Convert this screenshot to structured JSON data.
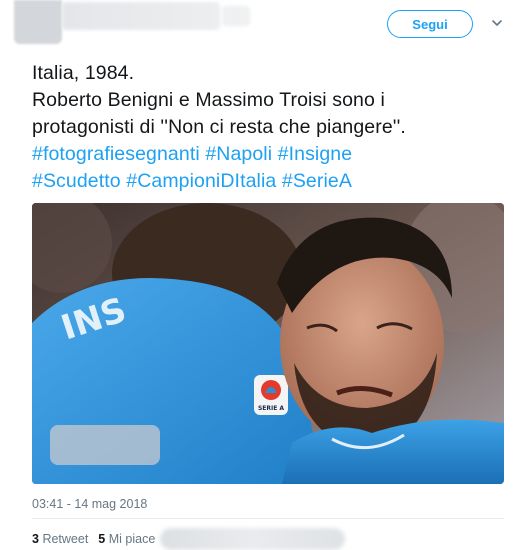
{
  "header": {
    "follow_label": "Segui"
  },
  "tweet": {
    "lines": [
      "Italia, 1984.",
      "Roberto Benigni e Massimo Troisi sono i",
      "protagonisti di ''Non ci resta che piangere''."
    ],
    "hashtag_lines": [
      [
        "#fotografiesegnanti",
        "#Napoli",
        "#Insigne"
      ],
      [
        "#Scudetto",
        "#CampioniDItalia",
        "#SerieA"
      ]
    ],
    "timestamp": "03:41 - 14 mag 2018",
    "retweets_count": "3",
    "retweets_label": "Retweet",
    "likes_count": "5",
    "likes_label": "Mi piace"
  },
  "photo": {
    "jersey_lettering": "INS",
    "badge_text": "SERIE A"
  },
  "colors": {
    "accent": "#1da1f2",
    "text": "#14171a",
    "muted": "#657786",
    "jersey": "#2a8fd6"
  },
  "icons": {
    "more": "chevron-down-icon"
  }
}
